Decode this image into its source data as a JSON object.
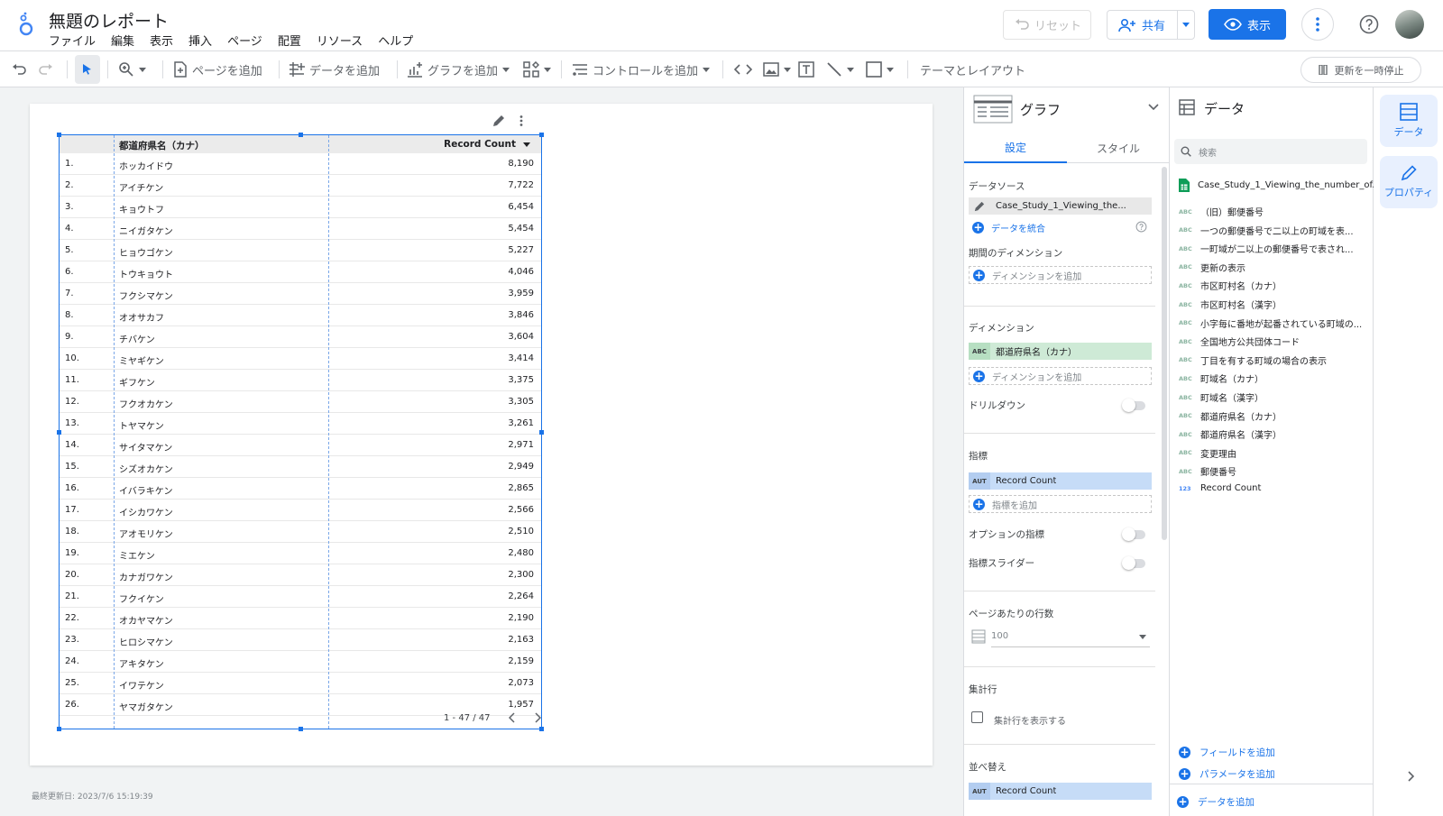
{
  "app": {
    "title": "無題のレポート",
    "menu": [
      "ファイル",
      "編集",
      "表示",
      "挿入",
      "ページ",
      "配置",
      "リソース",
      "ヘルプ"
    ],
    "reset_label": "リセット",
    "share_label": "共有",
    "view_label": "表示",
    "colors": {
      "accent": "#1a73e8",
      "canvas": "#f1f3f4",
      "dim_chip": "#ceead6",
      "metric_chip": "#c6dcf7"
    }
  },
  "toolbar": {
    "add_page": "ページを追加",
    "add_data": "データを追加",
    "add_chart": "グラフを追加",
    "add_control": "コントロールを追加",
    "theme_layout": "テーマとレイアウト",
    "pause_updates": "更新を一時停止"
  },
  "canvas": {
    "last_updated": "最終更新日: 2023/7/6 15:19:39"
  },
  "table": {
    "columns": [
      "都道府県名（カナ）",
      "Record Count"
    ],
    "rows": [
      [
        "1.",
        "ホッカイドウ",
        "8,190"
      ],
      [
        "2.",
        "アイチケン",
        "7,722"
      ],
      [
        "3.",
        "キョウトフ",
        "6,454"
      ],
      [
        "4.",
        "ニイガタケン",
        "5,454"
      ],
      [
        "5.",
        "ヒョウゴケン",
        "5,227"
      ],
      [
        "6.",
        "トウキョウト",
        "4,046"
      ],
      [
        "7.",
        "フクシマケン",
        "3,959"
      ],
      [
        "8.",
        "オオサカフ",
        "3,846"
      ],
      [
        "9.",
        "チバケン",
        "3,604"
      ],
      [
        "10.",
        "ミヤギケン",
        "3,414"
      ],
      [
        "11.",
        "ギフケン",
        "3,375"
      ],
      [
        "12.",
        "フクオカケン",
        "3,305"
      ],
      [
        "13.",
        "トヤマケン",
        "3,261"
      ],
      [
        "14.",
        "サイタマケン",
        "2,971"
      ],
      [
        "15.",
        "シズオカケン",
        "2,949"
      ],
      [
        "16.",
        "イバラキケン",
        "2,865"
      ],
      [
        "17.",
        "イシカワケン",
        "2,566"
      ],
      [
        "18.",
        "アオモリケン",
        "2,510"
      ],
      [
        "19.",
        "ミエケン",
        "2,480"
      ],
      [
        "20.",
        "カナガワケン",
        "2,300"
      ],
      [
        "21.",
        "フクイケン",
        "2,264"
      ],
      [
        "22.",
        "オカヤマケン",
        "2,190"
      ],
      [
        "23.",
        "ヒロシマケン",
        "2,163"
      ],
      [
        "24.",
        "アキタケン",
        "2,159"
      ],
      [
        "25.",
        "イワテケン",
        "2,073"
      ],
      [
        "26.",
        "ヤマガタケン",
        "1,957"
      ]
    ],
    "pagination": "1 - 47 / 47"
  },
  "graph_panel": {
    "title": "グラフ",
    "tabs": [
      "設定",
      "スタイル"
    ],
    "datasource_label": "データソース",
    "datasource_name": "Case_Study_1_Viewing_the...",
    "blend_label": "データを統合",
    "date_dim_label": "期間のディメンション",
    "add_dimension": "ディメンションを追加",
    "dimension_label": "ディメンション",
    "dimension_tag": "ABC",
    "dimension_value": "都道府県名（カナ）",
    "drilldown_label": "ドリルダウン",
    "metric_label": "指標",
    "metric_tag": "AUT",
    "metric_value": "Record Count",
    "add_metric": "指標を追加",
    "optional_metrics": "オプションの指標",
    "metric_slider": "指標スライダー",
    "rows_per_page_label": "ページあたりの行数",
    "rows_per_page": "100",
    "summary_row_label": "集計行",
    "summary_row_checkbox": "集計行を表示する",
    "sort_label": "並べ替え",
    "sort_tag": "AUT",
    "sort_value": "Record Count"
  },
  "data_panel": {
    "title": "データ",
    "search_placeholder": "検索",
    "source_name": "Case_Study_1_Viewing_the_number_of...",
    "fields": [
      {
        "type": "ABC",
        "name": "（旧）郵便番号"
      },
      {
        "type": "ABC",
        "name": "一つの郵便番号で二以上の町域を表..."
      },
      {
        "type": "ABC",
        "name": "一町域が二以上の郵便番号で表され..."
      },
      {
        "type": "ABC",
        "name": "更新の表示"
      },
      {
        "type": "ABC",
        "name": "市区町村名（カナ）"
      },
      {
        "type": "ABC",
        "name": "市区町村名（漢字）"
      },
      {
        "type": "ABC",
        "name": "小字毎に番地が起番されている町域の..."
      },
      {
        "type": "ABC",
        "name": "全国地方公共団体コード"
      },
      {
        "type": "ABC",
        "name": "丁目を有する町域の場合の表示"
      },
      {
        "type": "ABC",
        "name": "町域名（カナ）"
      },
      {
        "type": "ABC",
        "name": "町域名（漢字）"
      },
      {
        "type": "ABC",
        "name": "都道府県名（カナ）"
      },
      {
        "type": "ABC",
        "name": "都道府県名（漢字）"
      },
      {
        "type": "ABC",
        "name": "変更理由"
      },
      {
        "type": "ABC",
        "name": "郵便番号"
      },
      {
        "type": "123",
        "name": "Record Count"
      }
    ],
    "add_field": "フィールドを追加",
    "add_parameter": "パラメータを追加",
    "add_data": "データを追加"
  },
  "rail": {
    "data_label": "データ",
    "properties_label": "プロパティ"
  }
}
